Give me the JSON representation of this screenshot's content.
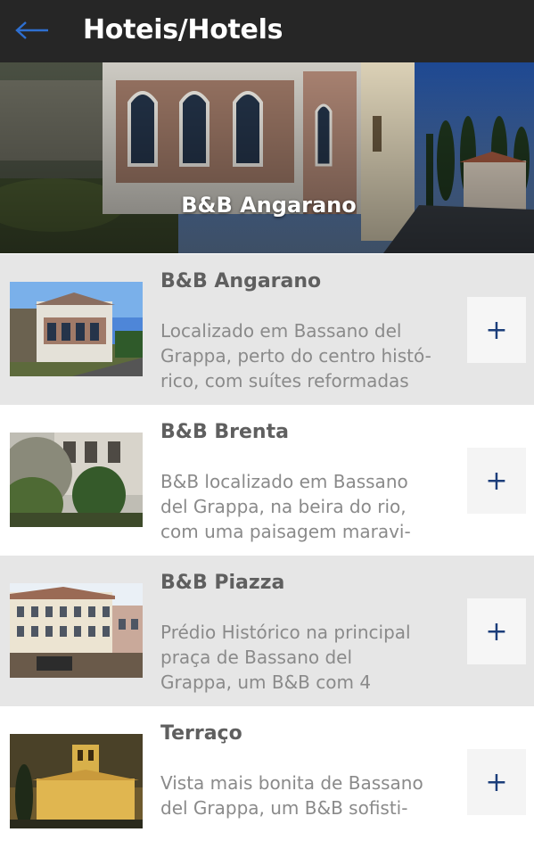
{
  "header": {
    "back_icon": "arrow-left-icon",
    "title": "Hoteis/Hotels"
  },
  "hero": {
    "title": "B&B Angarano"
  },
  "hotels": [
    {
      "name": "B&B Angarano",
      "description": "Localizado em Bassano del\nGrappa, perto do centro histó-\nrico, com suítes reformadas",
      "button": "+"
    },
    {
      "name": "B&B Brenta",
      "description": "B&B localizado em Bassano\ndel Grappa, na beira do rio,\ncom uma paisagem maravi-",
      "button": "+"
    },
    {
      "name": "B&B Piazza",
      "description": "Prédio Histórico na principal\npraça de Bassano del\nGrappa, um B&B com 4",
      "button": "+"
    },
    {
      "name": "Terraço",
      "description": "Vista mais bonita de Bassano\ndel Grappa, um B&B sofisti-",
      "button": "+"
    }
  ],
  "colors": {
    "topbar": "#262626",
    "accent": "#1b3d7a",
    "row_grey": "#e6e6e6"
  }
}
